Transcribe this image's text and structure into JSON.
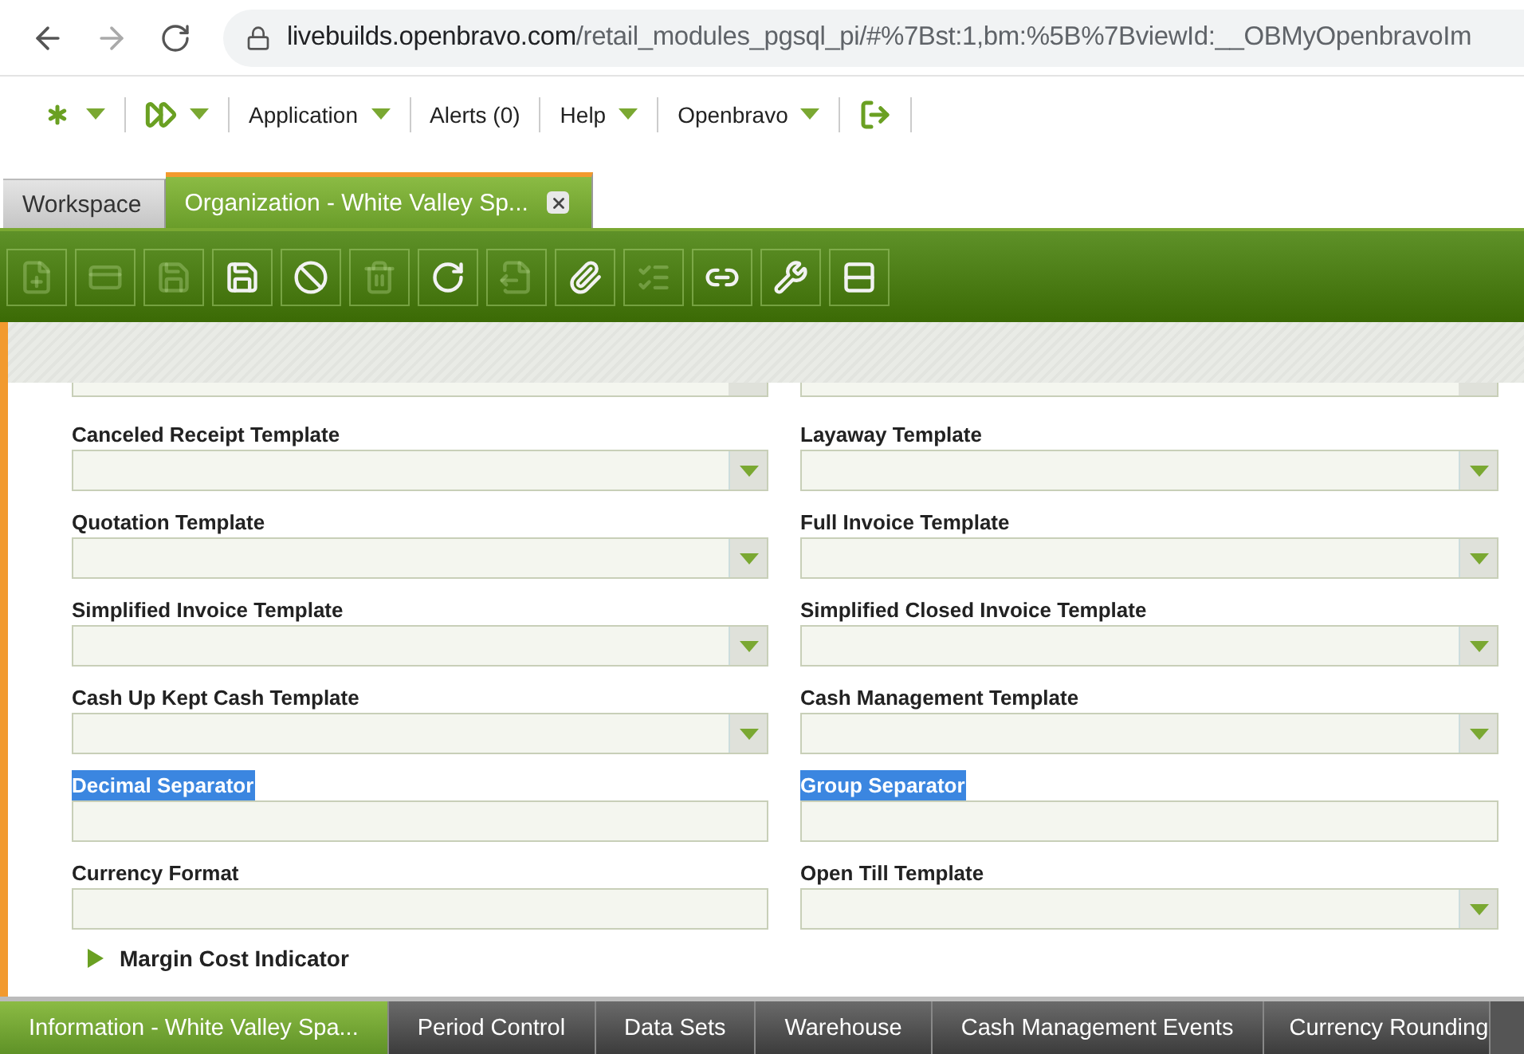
{
  "browser": {
    "url_host": "livebuilds.openbravo.com",
    "url_path": "/retail_modules_pgsql_pi/#%7Bst:1,bm:%5B%7BviewId:__OBMyOpenbravoIm"
  },
  "nav": [
    {
      "kind": "icon",
      "caret": true
    },
    {
      "kind": "icon",
      "caret": true
    },
    {
      "kind": "text",
      "label": "Application",
      "caret": true
    },
    {
      "kind": "text",
      "label": "Alerts (0)",
      "caret": false
    },
    {
      "kind": "text",
      "label": "Help",
      "caret": true
    },
    {
      "kind": "text",
      "label": "Openbravo",
      "caret": true
    },
    {
      "kind": "icon",
      "caret": false
    }
  ],
  "tabs": [
    {
      "label": "Workspace",
      "selected": false,
      "closable": false
    },
    {
      "label": "Organization - White Valley Sp...",
      "selected": true,
      "closable": true
    }
  ],
  "toolbar": [
    {
      "disabled": true
    },
    {
      "disabled": true
    },
    {
      "disabled": true
    },
    {
      "disabled": false
    },
    {
      "disabled": false
    },
    {
      "disabled": true
    },
    {
      "disabled": false
    },
    {
      "disabled": true
    },
    {
      "disabled": false
    },
    {
      "disabled": true
    },
    {
      "disabled": false
    },
    {
      "disabled": false
    },
    {
      "disabled": false
    }
  ],
  "form": {
    "rows": [
      [
        {
          "label": "Canceled Receipt Template",
          "kind": "dropdown",
          "highlighted": false
        },
        {
          "label": "Layaway Template",
          "kind": "dropdown",
          "highlighted": false
        }
      ],
      [
        {
          "label": "Quotation Template",
          "kind": "dropdown",
          "highlighted": false
        },
        {
          "label": "Full Invoice Template",
          "kind": "dropdown",
          "highlighted": false
        }
      ],
      [
        {
          "label": "Simplified Invoice Template",
          "kind": "dropdown",
          "highlighted": false
        },
        {
          "label": "Simplified Closed Invoice Template",
          "kind": "dropdown",
          "highlighted": false
        }
      ],
      [
        {
          "label": "Cash Up Kept Cash Template",
          "kind": "dropdown",
          "highlighted": false
        },
        {
          "label": "Cash Management Template",
          "kind": "dropdown",
          "highlighted": false
        }
      ],
      [
        {
          "label": "Decimal Separator",
          "kind": "text",
          "highlighted": true
        },
        {
          "label": "Group Separator",
          "kind": "text",
          "highlighted": true
        }
      ],
      [
        {
          "label": "Currency Format",
          "kind": "text",
          "highlighted": false
        },
        {
          "label": "Open Till Template",
          "kind": "dropdown",
          "highlighted": false
        }
      ]
    ],
    "section": {
      "label": "Margin Cost Indicator",
      "expanded": false
    }
  },
  "bottom_tabs": [
    {
      "label": "Information - White Valley Spa...",
      "selected": true
    },
    {
      "label": "Period Control",
      "selected": false
    },
    {
      "label": "Data Sets",
      "selected": false
    },
    {
      "label": "Warehouse",
      "selected": false
    },
    {
      "label": "Cash Management Events",
      "selected": false
    },
    {
      "label": "Currency Rounding",
      "selected": false
    }
  ]
}
